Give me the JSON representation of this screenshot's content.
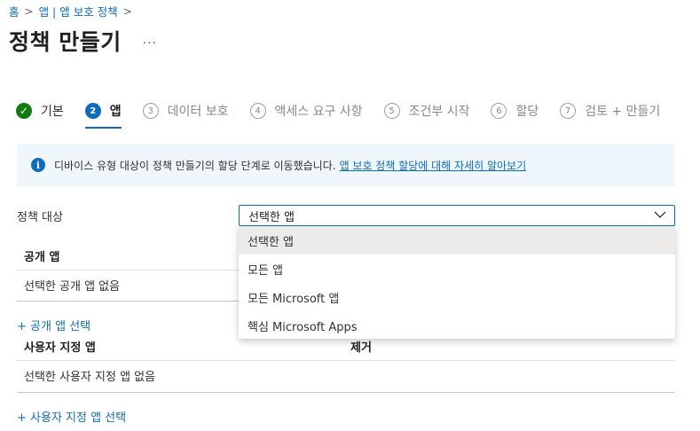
{
  "breadcrumb": {
    "home": "홈",
    "parent": "앱 | 앱 보호 정책"
  },
  "page": {
    "title": "정책 만들기",
    "more": "···"
  },
  "wizard": {
    "steps": [
      {
        "num": "✓",
        "label": "기본",
        "state": "done"
      },
      {
        "num": "2",
        "label": "앱",
        "state": "current"
      },
      {
        "num": "3",
        "label": "데이터 보호",
        "state": "todo"
      },
      {
        "num": "4",
        "label": "액세스 요구 사항",
        "state": "todo"
      },
      {
        "num": "5",
        "label": "조건부 시작",
        "state": "todo"
      },
      {
        "num": "6",
        "label": "할당",
        "state": "todo"
      },
      {
        "num": "7",
        "label": "검토 + 만들기",
        "state": "todo"
      }
    ]
  },
  "banner": {
    "text": "디바이스 유형 대상이 정책 만들기의 할당 단계로 이동했습니다.",
    "link": "앱 보호 정책 할당에 대해 자세히 알아보기"
  },
  "policy_target": {
    "label": "정책 대상",
    "value": "선택한 앱",
    "options": [
      "선택한 앱",
      "모든 앱",
      "모든 Microsoft 앱",
      "핵심 Microsoft Apps"
    ]
  },
  "public_apps": {
    "header": "공개 앱",
    "empty": "선택한 공개 앱 없음",
    "add_link": "+ 공개 앱 선택"
  },
  "custom_apps": {
    "header": "사용자 지정 앱",
    "remove_header": "제거",
    "empty": "선택한 사용자 지정 앱 없음",
    "add_link": "+ 사용자 지정 앱 선택"
  },
  "colors": {
    "accent": "#0f6cbd",
    "success": "#107c10",
    "banner_bg": "#eff6fc"
  }
}
